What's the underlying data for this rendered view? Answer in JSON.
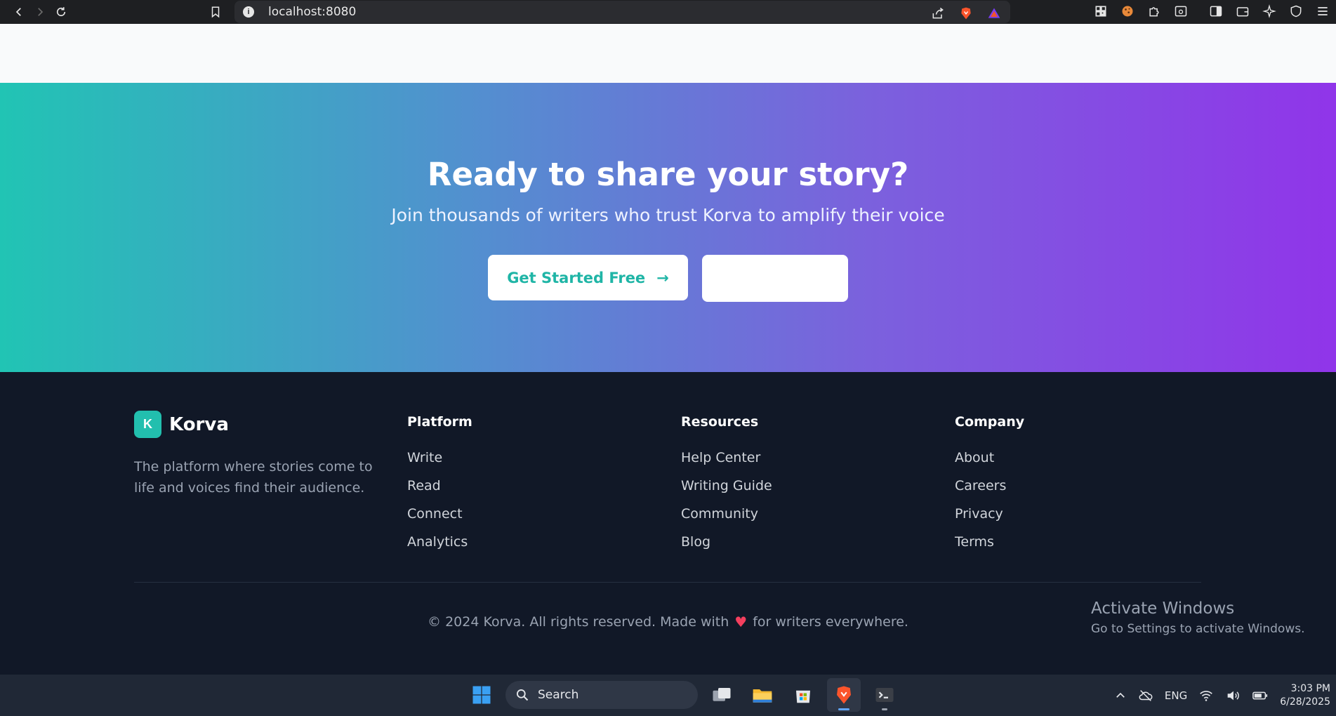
{
  "browser": {
    "url": "localhost:8080"
  },
  "cta": {
    "title": "Ready to share your story?",
    "subtitle": "Join thousands of writers who trust Korva to amplify their voice",
    "primary_button": "Get Started Free",
    "primary_arrow": "→",
    "secondary_button": ""
  },
  "footer": {
    "brand_initial": "K",
    "brand_name": "Korva",
    "brand_desc": "The platform where stories come to life and voices find their audience.",
    "columns": [
      {
        "title": "Platform",
        "links": [
          "Write",
          "Read",
          "Connect",
          "Analytics"
        ]
      },
      {
        "title": "Resources",
        "links": [
          "Help Center",
          "Writing Guide",
          "Community",
          "Blog"
        ]
      },
      {
        "title": "Company",
        "links": [
          "About",
          "Careers",
          "Privacy",
          "Terms"
        ]
      }
    ],
    "copyright_pre": "© 2024 Korva. All rights reserved. Made with",
    "copyright_heart": "♥",
    "copyright_post": "for writers everywhere."
  },
  "watermark": {
    "title": "Activate Windows",
    "subtitle": "Go to Settings to activate Windows."
  },
  "taskbar": {
    "search_label": "Search",
    "language": "ENG",
    "time": "3:03 PM",
    "date": "6/28/2025"
  },
  "colors": {
    "accent": "#21c4b4",
    "gradient_end": "#9035e9",
    "footer_bg": "#111827"
  }
}
